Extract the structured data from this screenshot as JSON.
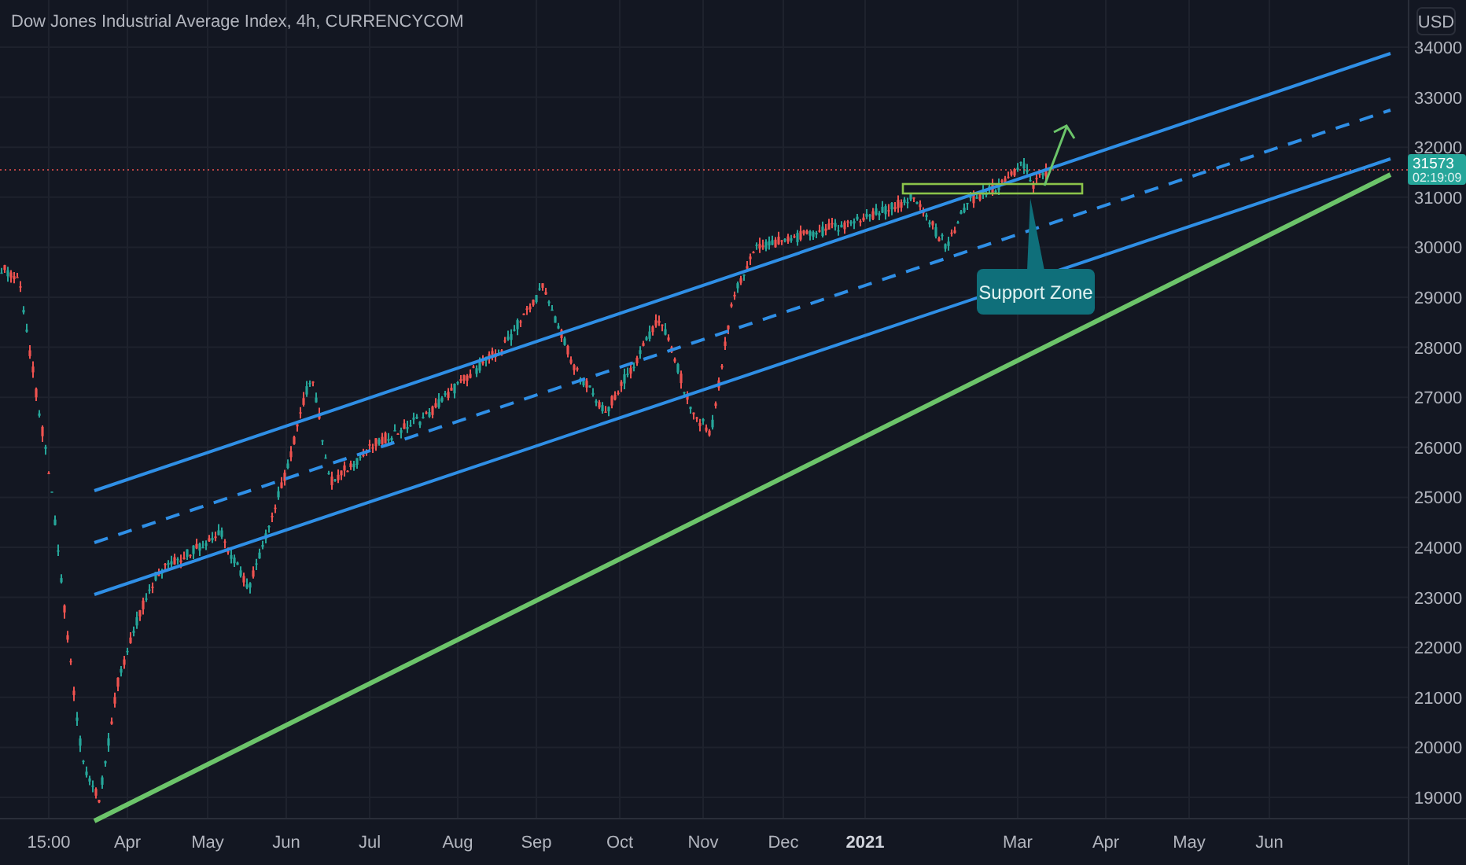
{
  "title": "Dow Jones Industrial Average Index, 4h, CURRENCYCOM",
  "currency_button": "USD",
  "last_price": {
    "value": "31573",
    "countdown": "02:19:09"
  },
  "price_axis": [
    "34000",
    "33000",
    "32000",
    "31000",
    "30000",
    "29000",
    "28000",
    "27000",
    "26000",
    "25000",
    "24000",
    "23000",
    "22000",
    "21000",
    "20000",
    "19000"
  ],
  "time_axis": [
    {
      "label": "15:00",
      "kind": "time"
    },
    {
      "label": "Apr",
      "kind": "month"
    },
    {
      "label": "May",
      "kind": "month"
    },
    {
      "label": "Jun",
      "kind": "month"
    },
    {
      "label": "Jul",
      "kind": "month"
    },
    {
      "label": "Aug",
      "kind": "month"
    },
    {
      "label": "Sep",
      "kind": "month"
    },
    {
      "label": "Oct",
      "kind": "month"
    },
    {
      "label": "Nov",
      "kind": "month"
    },
    {
      "label": "Dec",
      "kind": "month"
    },
    {
      "label": "2021",
      "kind": "year"
    },
    {
      "label": "Mar",
      "kind": "month"
    },
    {
      "label": "Apr",
      "kind": "month"
    },
    {
      "label": "May",
      "kind": "month"
    },
    {
      "label": "Jun",
      "kind": "month"
    }
  ],
  "annotation": {
    "text": "Support Zone"
  }
}
